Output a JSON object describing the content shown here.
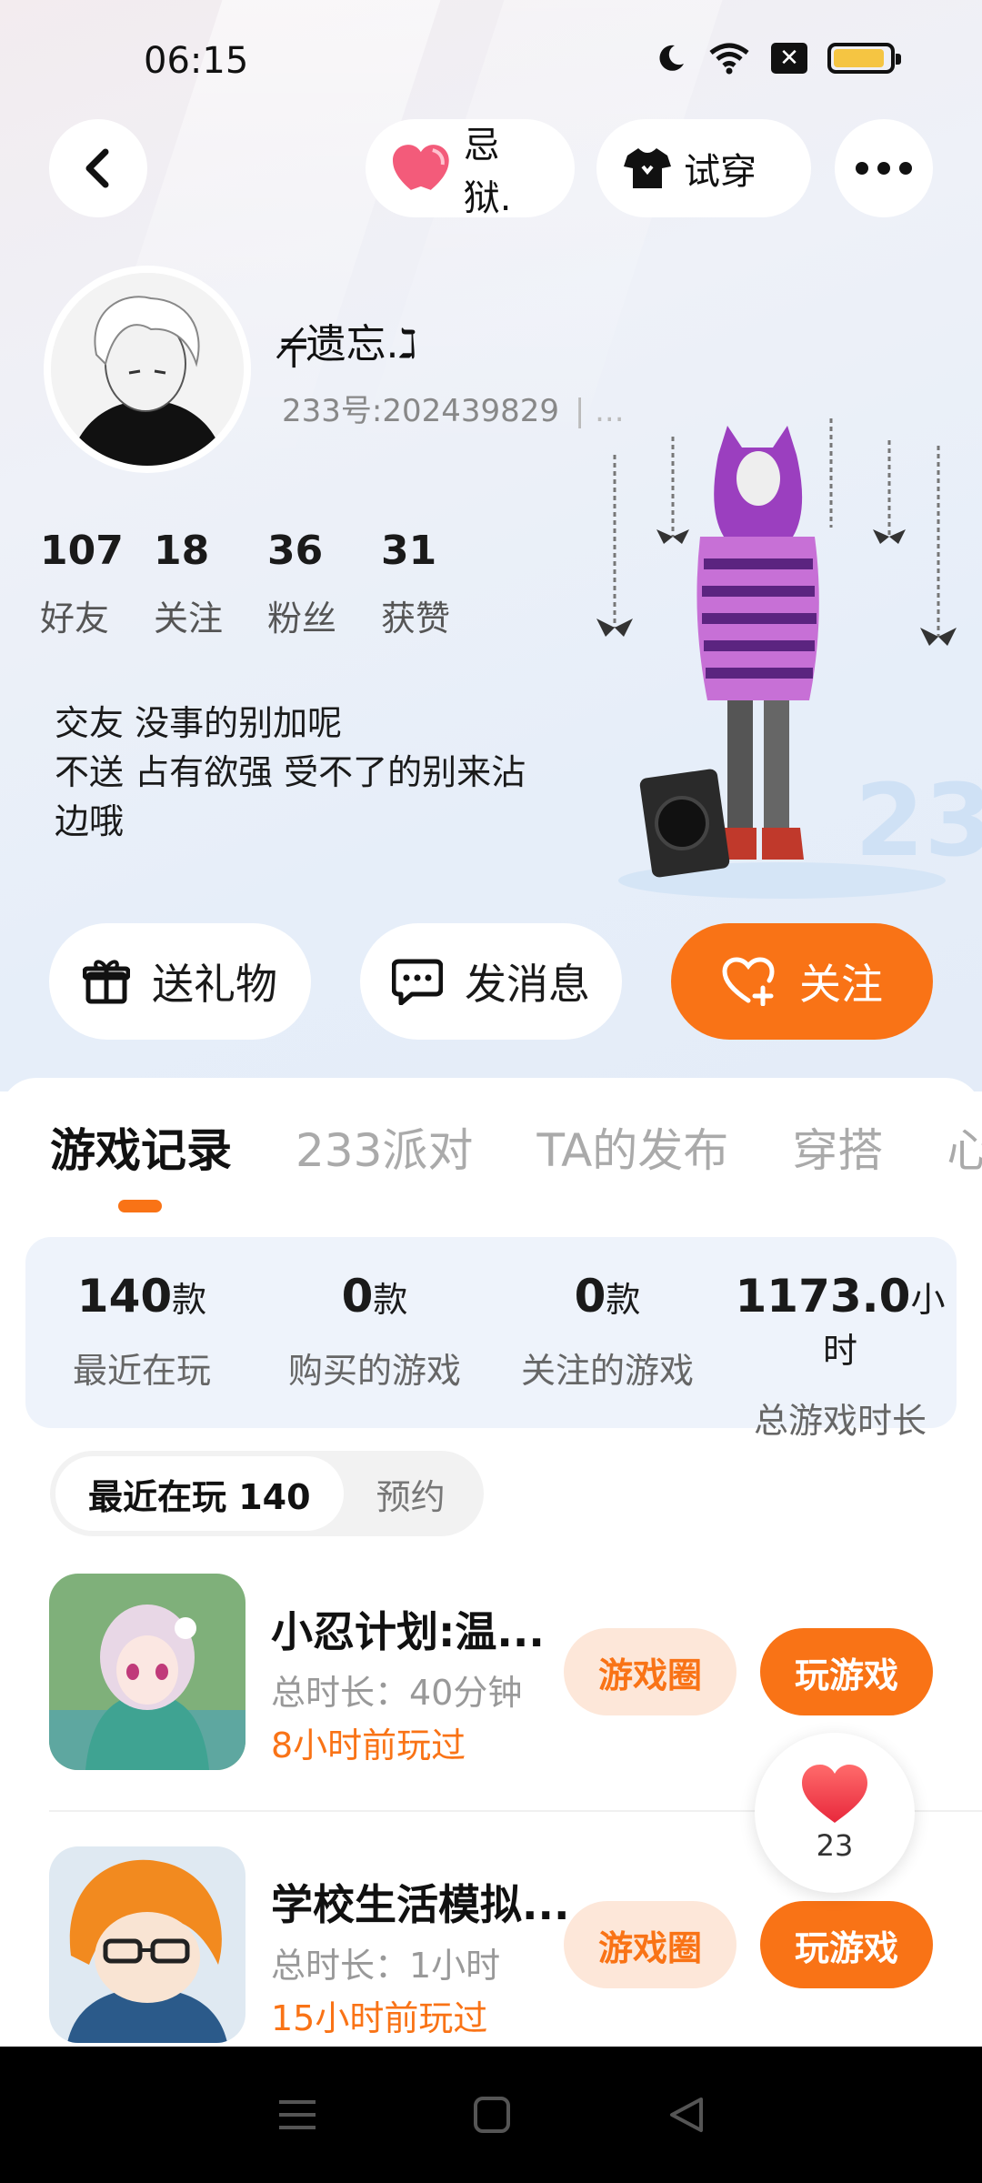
{
  "status_bar": {
    "time": "06:15"
  },
  "header": {
    "back_label": "",
    "mood_label": "忌狱.",
    "tryon_label": "试穿"
  },
  "profile": {
    "nickname": "╤̸遗忘.ℷ",
    "uid": "233号:202439829",
    "uid_more": "| ...",
    "stats": [
      {
        "num": "107",
        "label": "好友"
      },
      {
        "num": "18",
        "label": "关注"
      },
      {
        "num": "36",
        "label": "粉丝"
      },
      {
        "num": "31",
        "label": "获赞"
      }
    ],
    "bio": "交友  没事的别加呢\n不送  占有欲强 受不了的别来沾\n边哦"
  },
  "actions": {
    "gift": "送礼物",
    "message": "发消息",
    "follow": "关注"
  },
  "tabs": [
    "游戏记录",
    "233派对",
    "TA的发布",
    "穿搭",
    "心"
  ],
  "summary": [
    {
      "num": "140",
      "unit": "款",
      "label": "最近在玩"
    },
    {
      "num": "0",
      "unit": "款",
      "label": "购买的游戏"
    },
    {
      "num": "0",
      "unit": "款",
      "label": "关注的游戏"
    },
    {
      "num": "1173.0",
      "unit": "小时",
      "label": "总游戏时长"
    }
  ],
  "segment": {
    "recent": "最近在玩 140",
    "reserve": "预约"
  },
  "games": [
    {
      "title": "小忍计划:温...",
      "duration": "总时长：40分钟",
      "last_played": "8小时前玩过",
      "circle": "游戏圈",
      "play": "玩游戏"
    },
    {
      "title": "学校生活模拟...",
      "duration": "总时长：1小时",
      "last_played": "15小时前玩过",
      "circle": "游戏圈",
      "play": "玩游戏"
    }
  ],
  "like_count": "23",
  "colors": {
    "accent": "#f97316",
    "chip_bg": "#fde7d9",
    "summary_bg": "#eef3fb"
  }
}
